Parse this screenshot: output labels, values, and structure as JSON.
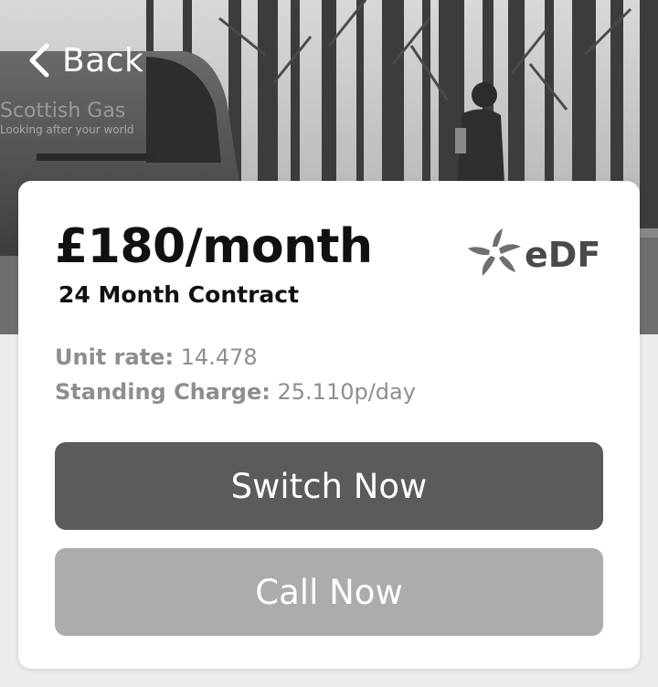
{
  "nav": {
    "back_label": "Back",
    "back_icon": "chevron-left-icon"
  },
  "hero": {
    "van_text_line1": "Scottish Gas",
    "van_text_line2": "Looking after your world"
  },
  "plan": {
    "price": "£180/month",
    "contract": "24 Month Contract",
    "supplier_logo_text": "eDF",
    "unit_rate_label": "Unit rate:",
    "unit_rate_value": "14.478",
    "standing_charge_label": "Standing Charge:",
    "standing_charge_value": "25.110p/day"
  },
  "actions": {
    "switch_label": "Switch Now",
    "call_label": "Call Now"
  },
  "colors": {
    "switch_button": "#5b5b5b",
    "call_button": "#acacac",
    "muted_text": "#8e8e8e",
    "card_background": "#ffffff"
  }
}
